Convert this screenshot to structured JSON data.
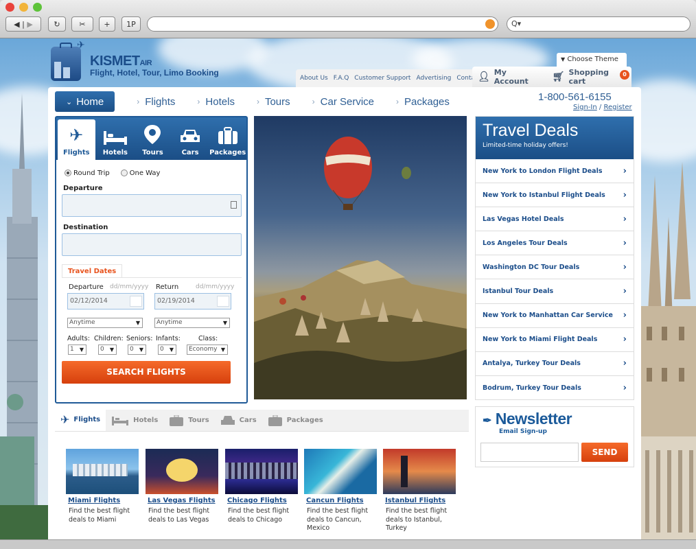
{
  "browser": {
    "search_placeholder": "Q▾"
  },
  "header": {
    "brand_name": "KISMET",
    "brand_suffix": "AIR",
    "tagline": "Flight, Hotel, Tour, Limo Booking",
    "choose_theme": "Choose Theme",
    "top_links": [
      "About Us",
      "F.A.Q",
      "Customer Support",
      "Advertising",
      "Contact"
    ],
    "my_account": "My Account",
    "shopping_cart": "Shopping cart",
    "cart_count": "0"
  },
  "nav": {
    "home": "Home",
    "items": [
      "Flights",
      "Hotels",
      "Tours",
      "Car Service",
      "Packages"
    ],
    "phone": "1-800-561-6155",
    "sign_in": "Sign-In",
    "register": "Register"
  },
  "search": {
    "tabs": [
      "Flights",
      "Hotels",
      "Tours",
      "Cars",
      "Packages"
    ],
    "round_trip": "Round Trip",
    "one_way": "One Way",
    "departure_label": "Departure",
    "destination_label": "Destination",
    "travel_dates": "Travel Dates",
    "departure_date_label": "Departure",
    "return_date_label": "Return",
    "date_format": "dd/mm/yyyy",
    "departure_date": "02/12/2014",
    "return_date": "02/19/2014",
    "anytime": "Anytime",
    "adults_label": "Adults:",
    "children_label": "Children:",
    "seniors_label": "Seniors:",
    "infants_label": "Infants:",
    "class_label": "Class:",
    "adults": "1",
    "children": "0",
    "seniors": "0",
    "infants": "0",
    "class": "Economy",
    "button": "SEARCH FLIGHTS"
  },
  "deals": {
    "title": "Travel Deals",
    "subtitle": "Limited-time holiday offers!",
    "items": [
      "New York to London Flight Deals",
      "New York to Istanbul Flight Deals",
      "Las Vegas Hotel Deals",
      "Los Angeles Tour Deals",
      "Washington DC Tour Deals",
      "Istanbul Tour Deals",
      "New York to Manhattan Car Service",
      "New York to Miami Flight Deals",
      "Antalya, Turkey Tour Deals",
      "Bodrum, Turkey Tour Deals"
    ]
  },
  "bottom_tabs": [
    "Flights",
    "Hotels",
    "Tours",
    "Cars",
    "Packages"
  ],
  "destinations": [
    {
      "name": "Miami Flights",
      "desc": "Find the best flight deals to Miami"
    },
    {
      "name": "Las Vegas Flights",
      "desc": "Find the best flight deals to Las Vegas"
    },
    {
      "name": "Chicago Flights",
      "desc": "Find the best flight deals to Chicago"
    },
    {
      "name": "Cancun Flights",
      "desc": "Find the best flight deals to Cancun, Mexico"
    },
    {
      "name": "Istanbul Flights",
      "desc": "Find the best flight deals to Istanbul, Turkey"
    }
  ],
  "newsletter": {
    "title": "Newsletter",
    "subtitle": "Email Sign-up",
    "button": "SEND"
  },
  "colors": {
    "brand_blue": "#1f5a97",
    "accent_orange": "#e8531d"
  }
}
